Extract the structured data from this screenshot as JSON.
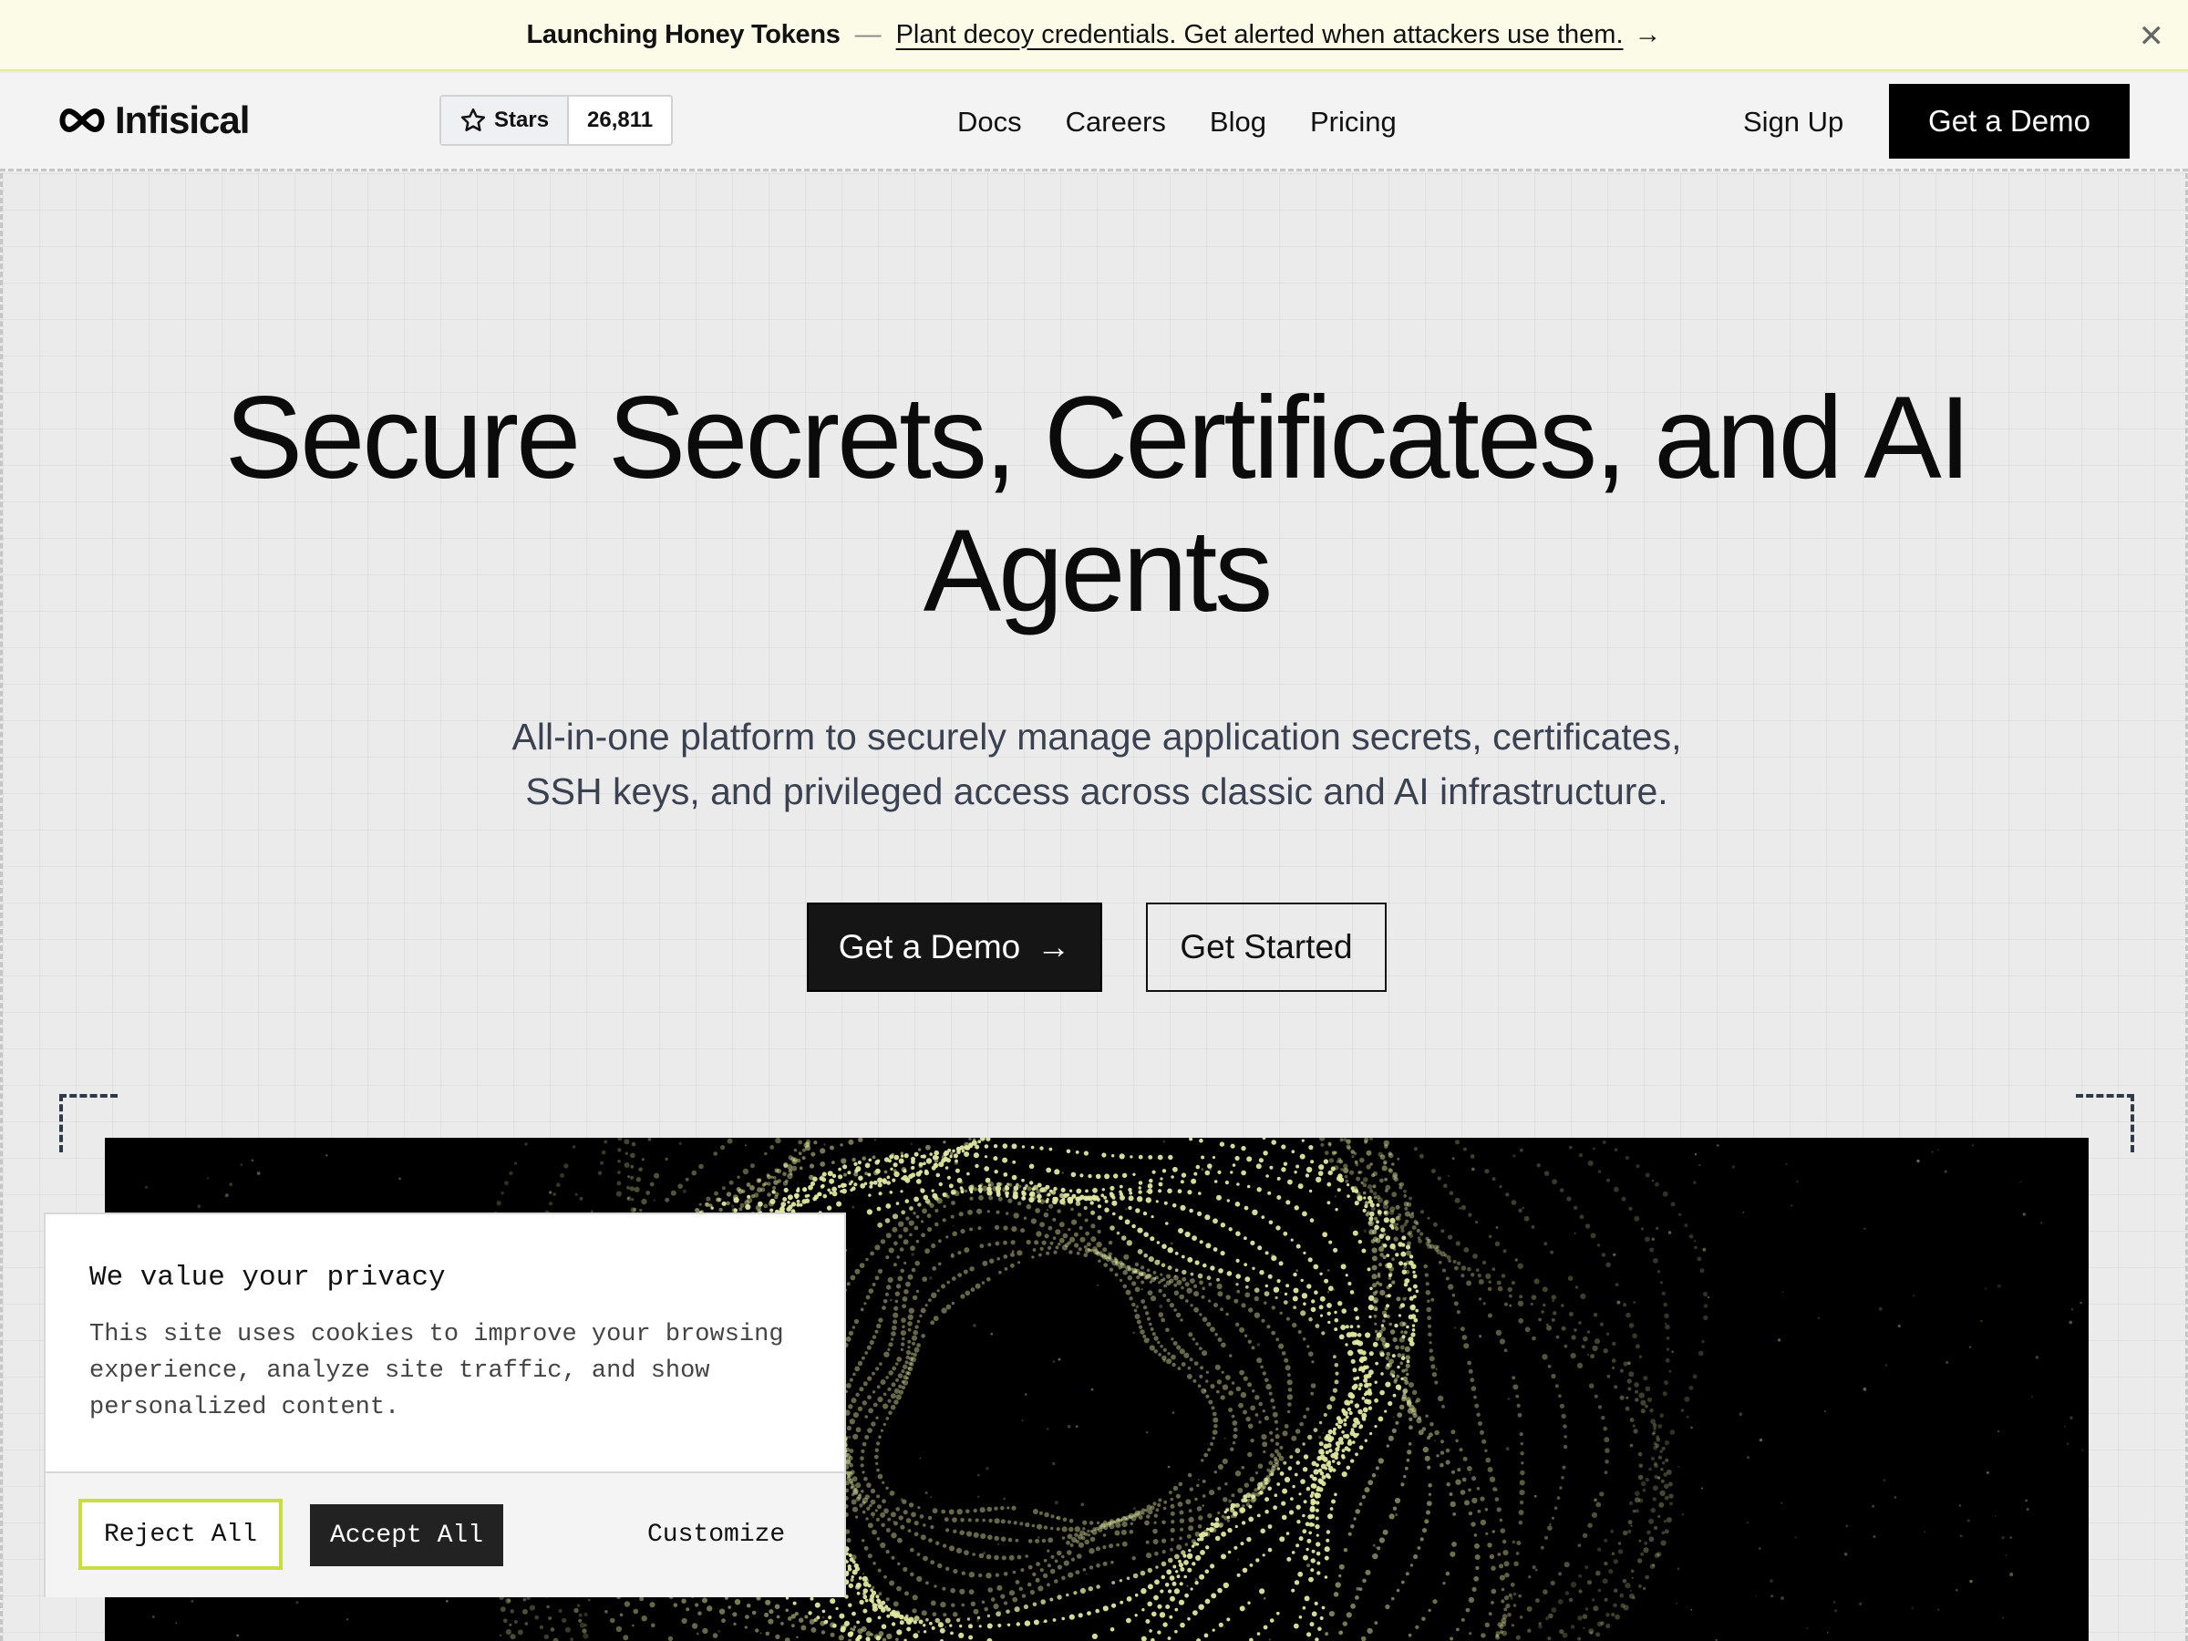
{
  "announcement": {
    "title": "Launching Honey Tokens",
    "separator": "—",
    "link_text": "Plant decoy credentials. Get alerted when attackers use them.",
    "arrow": "→",
    "close": "✕"
  },
  "nav": {
    "brand": "Infisical",
    "stars_label": "Stars",
    "stars_count": "26,811",
    "links": [
      "Docs",
      "Careers",
      "Blog",
      "Pricing"
    ],
    "signup": "Sign Up",
    "demo": "Get a Demo"
  },
  "hero": {
    "headline_line1": "Secure Secrets, Certificates, and AI",
    "headline_line2": "Agents",
    "sub_line1": "All-in-one platform to securely manage application secrets, certificates,",
    "sub_line2": "SSH keys, and privileged access across classic and AI infrastructure.",
    "cta_primary": "Get a Demo",
    "cta_primary_arrow": "→",
    "cta_secondary": "Get Started"
  },
  "cookie": {
    "title": "We value your privacy",
    "body": "This site uses cookies to improve your browsing experience, analyze site traffic, and show personalized content.",
    "reject": "Reject All",
    "accept": "Accept All",
    "customize": "Customize"
  },
  "colors": {
    "announce_bg": "#fbfbe8",
    "accent_lime": "#c8dd3e",
    "particle": "#dfe7a0",
    "dark": "#000000"
  }
}
